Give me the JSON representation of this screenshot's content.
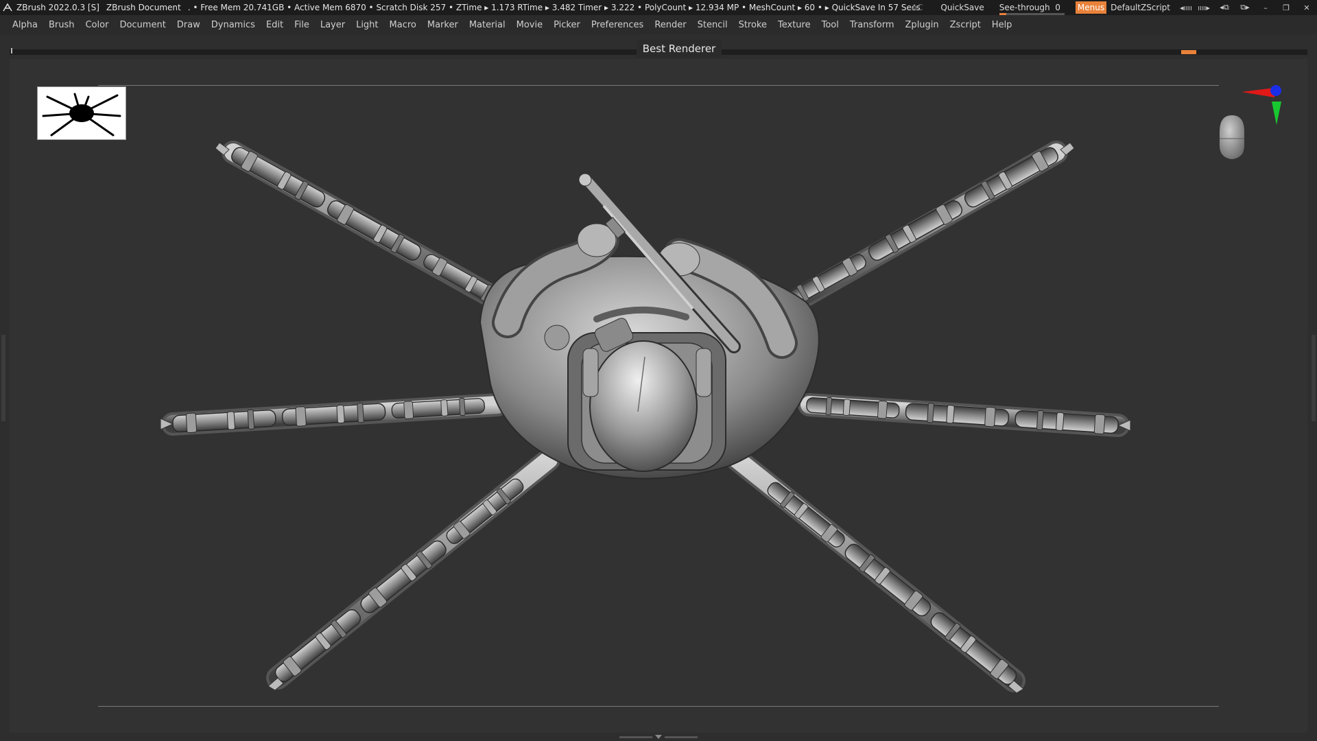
{
  "titlebar": {
    "app_title": "ZBrush 2022.0.3 [S]",
    "document": "ZBrush Document",
    "status": ". • Free Mem 20.741GB • Active Mem 6870 • Scratch Disk 257 • ZTime ▸ 1.173 RTime ▸ 3.482 Timer ▸ 3.222 • PolyCount ▸ 12.934 MP • MeshCount ▸ 60 • ▸ QuickSave In 57 Secs",
    "ac_label": "AC",
    "quicksave_label": "QuickSave",
    "seethrough_label": "See-through",
    "seethrough_value": "0",
    "seethrough_level": 0.0,
    "menus_label": "Menus",
    "script_label": "DefaultZScript"
  },
  "menubar": {
    "items": [
      "Alpha",
      "Brush",
      "Color",
      "Document",
      "Draw",
      "Dynamics",
      "Edit",
      "File",
      "Layer",
      "Light",
      "Macro",
      "Marker",
      "Material",
      "Movie",
      "Picker",
      "Preferences",
      "Render",
      "Stencil",
      "Stroke",
      "Texture",
      "Tool",
      "Transform",
      "Zplugin",
      "Zscript",
      "Help"
    ]
  },
  "render": {
    "label": "Best Renderer",
    "progress_color": "#e8823a"
  },
  "colors": {
    "accent": "#e8823a",
    "canvas": "#323232",
    "menubar": "#2b2b2b",
    "titlebar": "#1c1c1c"
  },
  "icons": {
    "app": "zbrush-logo-icon",
    "gyro": "axis-gizmo-icon",
    "head": "head-navigator-icon",
    "thumbnail": "spider-thumbnail"
  }
}
